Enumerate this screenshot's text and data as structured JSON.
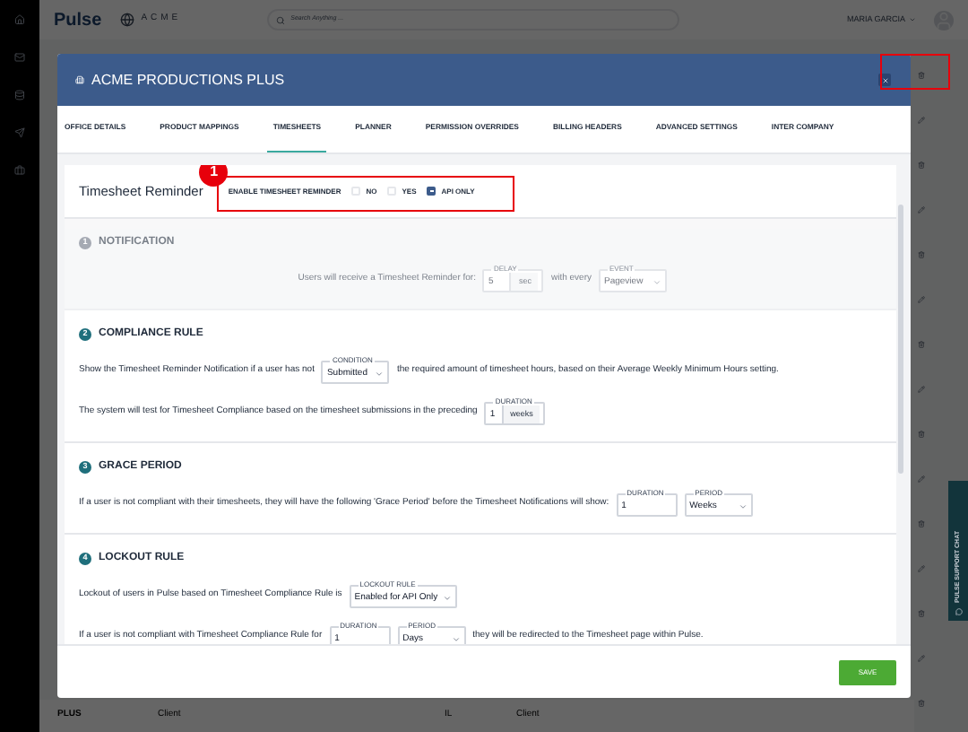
{
  "header": {
    "logo": "Pulse",
    "brand": "ACME",
    "search": {
      "placeholder": "Search Anything ..."
    },
    "user": "MARIA GARCIA"
  },
  "background_row": [
    "PLUS",
    "Client",
    "IL",
    "Client"
  ],
  "modal": {
    "title": "ACME PRODUCTIONS PLUS",
    "tabs": [
      {
        "label": "OFFICE DETAILS",
        "selected": false
      },
      {
        "label": "PRODUCT MAPPINGS",
        "selected": false
      },
      {
        "label": "TIMESHEETS",
        "selected": true
      },
      {
        "label": "PLANNER",
        "selected": false
      },
      {
        "label": "PERMISSION OVERRIDES",
        "selected": false
      },
      {
        "label": "BILLING HEADERS",
        "selected": false
      },
      {
        "label": "ADVANCED SETTINGS",
        "selected": false
      },
      {
        "label": "INTER COMPANY",
        "selected": false
      }
    ],
    "reminder": {
      "title": "Timesheet Reminder",
      "label": "ENABLE TIMESHEET REMINDER",
      "options": [
        {
          "label": "NO",
          "selected": false
        },
        {
          "label": "YES",
          "selected": false
        },
        {
          "label": "API ONLY",
          "selected": true
        }
      ]
    },
    "sections": [
      {
        "number": "1",
        "title": "NOTIFICATION",
        "disabled": true,
        "lines": [
          [
            {
              "kind": "text",
              "text": "Users will receive a Timesheet Reminder for:"
            },
            {
              "kind": "input",
              "label": "DELAY",
              "value": "5",
              "suffix": "sec"
            },
            {
              "kind": "text",
              "text": "with every"
            },
            {
              "kind": "select",
              "label": "EVENT",
              "value": "Pageview"
            }
          ]
        ]
      },
      {
        "number": "2",
        "title": "COMPLIANCE RULE",
        "disabled": false,
        "lines": [
          [
            {
              "kind": "text",
              "text": "Show the Timesheet Reminder Notification if a user has not"
            },
            {
              "kind": "select",
              "label": "CONDITION",
              "value": "Submitted"
            },
            {
              "kind": "text",
              "text": "the required amount of timesheet hours, based on their Average Weekly Minimum Hours setting."
            }
          ],
          [
            {
              "kind": "text",
              "text": "The system will test for Timesheet Compliance based on the timesheet submissions in the preceding"
            },
            {
              "kind": "input",
              "label": "DURATION",
              "value": "1",
              "suffix": "weeks"
            }
          ]
        ]
      },
      {
        "number": "3",
        "title": "GRACE PERIOD",
        "disabled": false,
        "lines": [
          [
            {
              "kind": "text",
              "text": "If a user is not compliant with their timesheets, they will have the following 'Grace Period' before the Timesheet Notifications will show:"
            },
            {
              "kind": "input",
              "label": "DURATION",
              "value": "1"
            },
            {
              "kind": "select",
              "label": "PERIOD",
              "value": "Weeks"
            }
          ]
        ]
      },
      {
        "number": "4",
        "title": "LOCKOUT RULE",
        "disabled": false,
        "lines": [
          [
            {
              "kind": "text",
              "text": "Lockout of users in Pulse based on Timesheet Compliance Rule is"
            },
            {
              "kind": "select",
              "label": "LOCKOUT RULE",
              "value": "Enabled for API Only"
            }
          ],
          [
            {
              "kind": "text",
              "text": "If a user is not compliant with Timesheet Compliance Rule for"
            },
            {
              "kind": "input",
              "label": "DURATION",
              "value": "1"
            },
            {
              "kind": "select",
              "label": "PERIOD",
              "value": "Days"
            },
            {
              "kind": "text",
              "text": "they will be redirected to the Timesheet page within Pulse."
            }
          ]
        ]
      }
    ],
    "save": "SAVE"
  },
  "callout": "1",
  "chat": "PULSE SUPPORT CHAT"
}
